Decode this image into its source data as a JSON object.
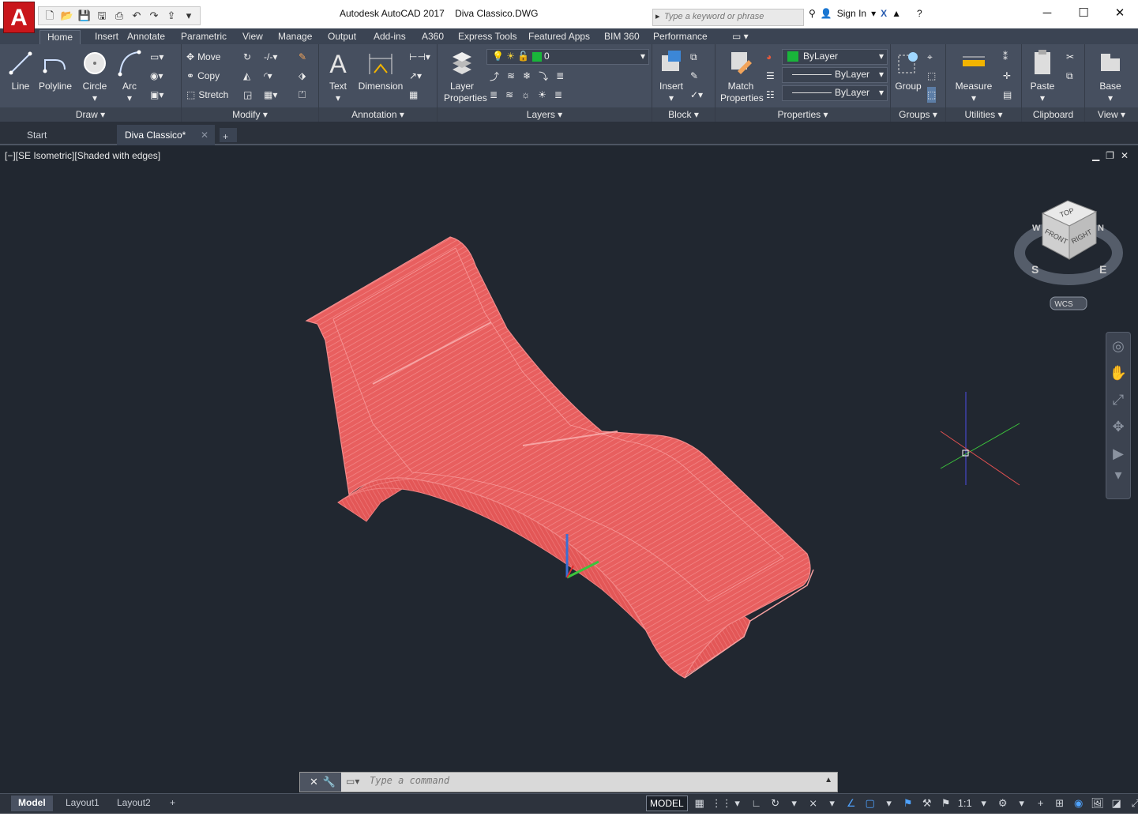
{
  "app": {
    "title": "Autodesk AutoCAD 2017",
    "document": "Diva Classico.DWG",
    "logo": "A",
    "search_placeholder": "Type a keyword or phrase",
    "sign_in": "Sign In"
  },
  "ribbon_tabs": [
    "Home",
    "Insert",
    "Annotate",
    "Parametric",
    "View",
    "Manage",
    "Output",
    "Add-ins",
    "A360",
    "Express Tools",
    "Featured Apps",
    "BIM 360",
    "Performance"
  ],
  "panels": {
    "draw": {
      "title": "Draw",
      "line": "Line",
      "polyline": "Polyline",
      "circle": "Circle",
      "arc": "Arc"
    },
    "modify": {
      "title": "Modify",
      "move": "Move",
      "copy": "Copy",
      "stretch": "Stretch"
    },
    "annotation": {
      "title": "Annotation",
      "text": "Text",
      "dimension": "Dimension"
    },
    "layers": {
      "title": "Layers",
      "layer_properties": "Layer\nProperties",
      "current_layer": "0"
    },
    "block": {
      "title": "Block",
      "insert": "Insert"
    },
    "properties": {
      "title": "Properties",
      "match": "Match\nProperties",
      "color": "ByLayer",
      "linetype": "ByLayer",
      "lineweight": "ByLayer"
    },
    "groups": {
      "title": "Groups",
      "group": "Group"
    },
    "utilities": {
      "title": "Utilities",
      "measure": "Measure"
    },
    "clipboard": {
      "title": "Clipboard",
      "paste": "Paste"
    },
    "view": {
      "title": "View",
      "base": "Base"
    }
  },
  "file_tabs": [
    {
      "label": "Start"
    },
    {
      "label": "Diva Classico*"
    }
  ],
  "viewport": {
    "label": "[−][SE Isometric][Shaded with edges]",
    "viewcube": {
      "top": "TOP",
      "front": "FRONT",
      "right": "RIGHT",
      "s": "S",
      "e": "E",
      "w": "W",
      "n": "N",
      "wcs": "WCS"
    }
  },
  "command": {
    "placeholder": "Type a command"
  },
  "layout_tabs": [
    "Model",
    "Layout1",
    "Layout2"
  ],
  "status": {
    "model": "MODEL",
    "scale": "1:1"
  },
  "colors": {
    "accent": "#c9161b",
    "model_fill": "#e85a5a",
    "model_edges": "#f07a7a"
  }
}
